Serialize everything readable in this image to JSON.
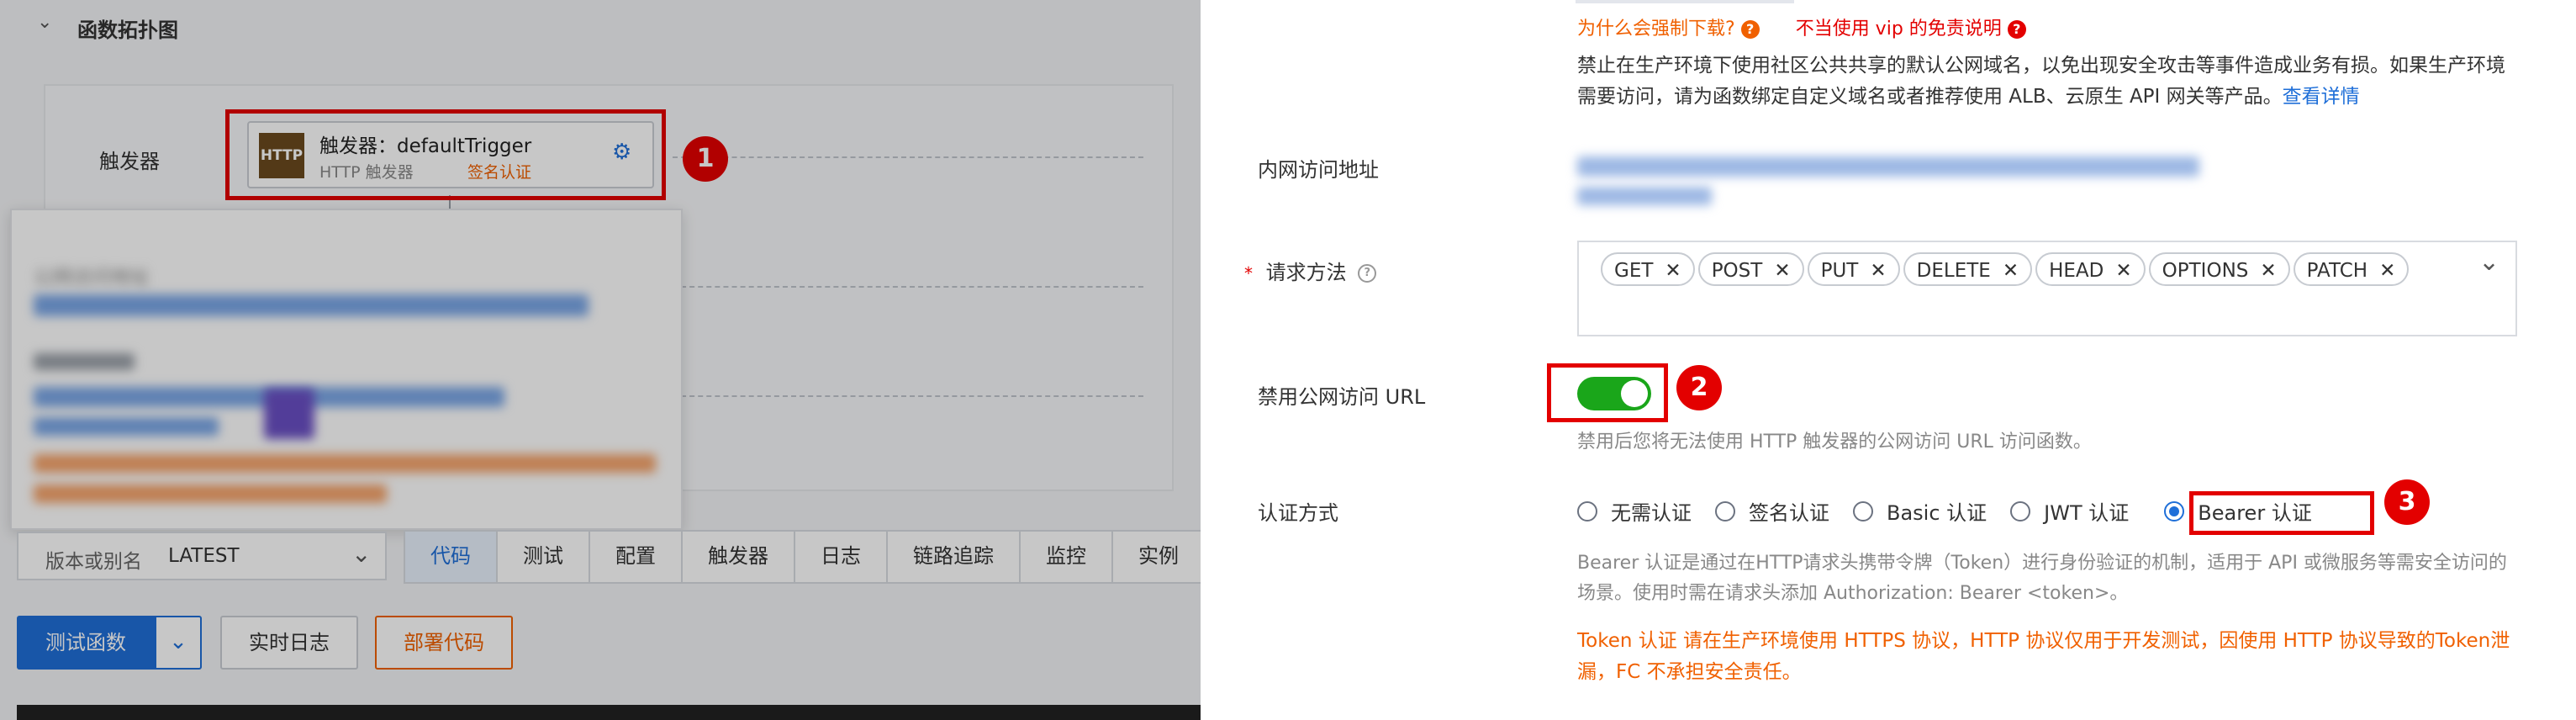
{
  "left": {
    "section_title": "函数拓扑图",
    "trigger_row_label": "触发器",
    "trigger": {
      "badge": "HTTP",
      "name": "触发器：defaultTrigger",
      "type": "HTTP 触发器",
      "auth": "签名认证"
    },
    "popover": {
      "title": "公网访问地址"
    },
    "version_label": "版本或别名",
    "version_value": "LATEST",
    "tabs": [
      "代码",
      "测试",
      "配置",
      "触发器",
      "日志",
      "链路追踪",
      "监控",
      "实例"
    ],
    "active_tab": "代码",
    "test_button": "测试函数",
    "log_button": "实时日志",
    "deploy_button": "部署代码",
    "marker_1": "1"
  },
  "right": {
    "why_force_download": "为什么会强制下载?",
    "vip_note": "不当使用 vip 的免责说明",
    "warning_text": "禁止在生产环境下使用社区公共共享的默认公网域名，以免出现安全攻击等事件造成业务有损。如果生产环境需要访问，请为函数绑定自定义域名或者推荐使用 ALB、云原生 API 网关等产品。",
    "view_details": "查看详情",
    "internal_url_label": "内网访问地址",
    "method_label": "请求方法",
    "methods": [
      "GET",
      "POST",
      "PUT",
      "DELETE",
      "HEAD",
      "OPTIONS",
      "PATCH"
    ],
    "disable_public_label": "禁用公网访问 URL",
    "disable_public_on": true,
    "disable_public_hint": "禁用后您将无法使用 HTTP 触发器的公网访问 URL 访问函数。",
    "auth_label": "认证方式",
    "auth_options": [
      "无需认证",
      "签名认证",
      "Basic 认证",
      "JWT 认证",
      "Bearer 认证"
    ],
    "auth_selected": "Bearer 认证",
    "bearer_desc": "Bearer 认证是通过在HTTP请求头携带令牌（Token）进行身份验证的机制，适用于 API 或微服务等需安全访问的场景。使用时需在请求头添加 Authorization: Bearer <token>。",
    "token_warning": "Token 认证 请在生产环境使用 HTTPS 协议，HTTP 协议仅用于开发测试，因使用 HTTP 协议导致的Token泄漏，FC 不承担安全责任。",
    "marker_2": "2",
    "marker_3": "3"
  },
  "colors": {
    "accent": "#1f6fd8",
    "warning": "#f06000",
    "danger": "#e30000",
    "switch_on": "#1aa61a"
  }
}
